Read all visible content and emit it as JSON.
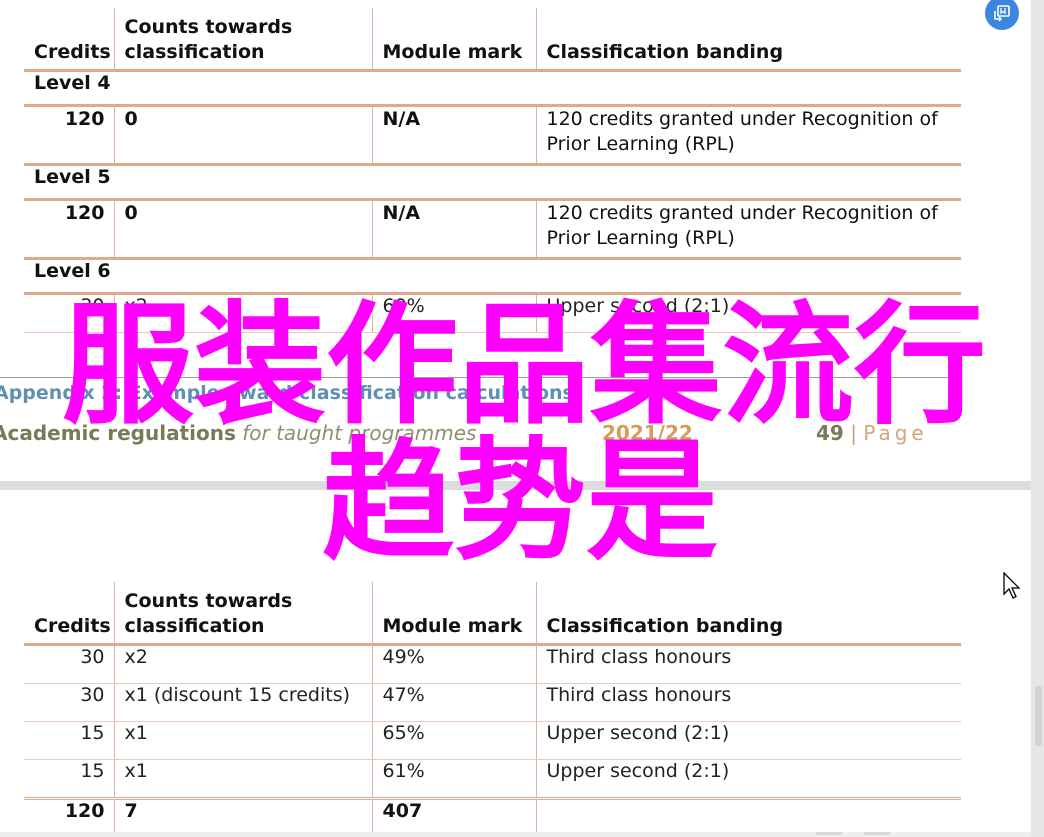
{
  "table1": {
    "headers": {
      "credits": "Credits",
      "counts": "Counts towards classification",
      "mark": "Module mark",
      "banding": "Classification banding"
    },
    "levels": [
      {
        "label": "Level 4",
        "row": {
          "credits": "120",
          "counts": "0",
          "mark": "N/A",
          "banding": "120 credits granted under Recognition of Prior Learning (RPL)"
        }
      },
      {
        "label": "Level 5",
        "row": {
          "credits": "120",
          "counts": "0",
          "mark": "N/A",
          "banding": "120 credits granted under Recognition of Prior Learning (RPL)"
        }
      },
      {
        "label": "Level 6",
        "row": {
          "credits": "30",
          "counts": "x2",
          "mark": "60%",
          "banding": "Upper second (2:1)"
        }
      }
    ]
  },
  "footer": {
    "appendix": "Appendix 2: Example award classification calculations",
    "regulations_bold": "Academic regulations",
    "regulations_italic": " for taught programmes",
    "year": "2021/22",
    "page_number": "49",
    "separator": "|",
    "page_word": "Page"
  },
  "table2": {
    "headers": {
      "credits": "Credits",
      "counts": "Counts towards classification",
      "mark": "Module mark",
      "banding": "Classification banding"
    },
    "rows": [
      {
        "credits": "30",
        "counts": "x2",
        "mark": "49%",
        "banding": "Third class honours"
      },
      {
        "credits": "30",
        "counts": "x1 (discount 15 credits)",
        "mark": "47%",
        "banding": "Third class honours"
      },
      {
        "credits": "15",
        "counts": "x1",
        "mark": "65%",
        "banding": "Upper second (2:1)"
      },
      {
        "credits": "15",
        "counts": "x1",
        "mark": "61%",
        "banding": "Upper second (2:1)"
      }
    ],
    "total": {
      "credits": "120",
      "counts": "7",
      "mark": "407"
    }
  },
  "watermark": {
    "line1": "服装作品集流行",
    "line2": "趋势是"
  },
  "icons": {
    "fab": "translate-bookmark-icon",
    "cursor": "mouse-pointer-icon"
  },
  "colors": {
    "table_rule": "#dfa98f",
    "appendix_text": "#5f8fb3",
    "year_text": "#d99a58",
    "watermark": "#ff00ff",
    "fab_bg": "#3a86e0"
  }
}
